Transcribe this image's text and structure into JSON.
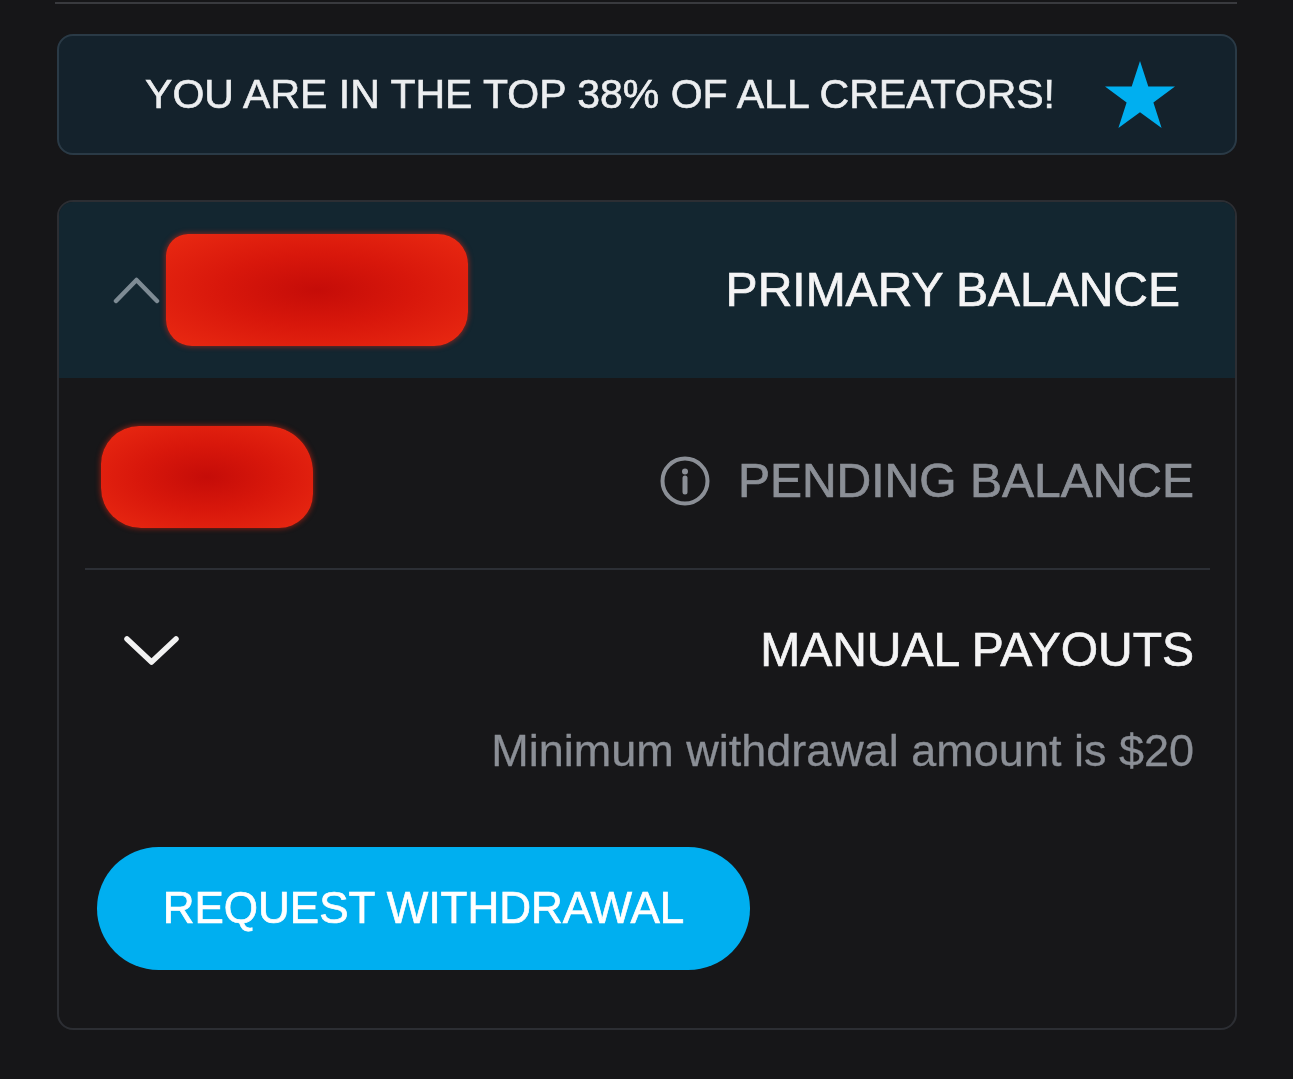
{
  "top_banner": {
    "text": "YOU ARE IN THE TOP 38% OF ALL CREATORS!"
  },
  "balance_card": {
    "primary_balance": {
      "label": "PRIMARY BALANCE",
      "expanded": true,
      "redacted": true
    },
    "pending_balance": {
      "label": "PENDING BALANCE",
      "redacted": true
    },
    "manual_payouts": {
      "label": "MANUAL PAYOUTS",
      "expanded": false,
      "note": "Minimum withdrawal amount is $20"
    },
    "request_button": {
      "label": "REQUEST WITHDRAWAL"
    }
  }
}
